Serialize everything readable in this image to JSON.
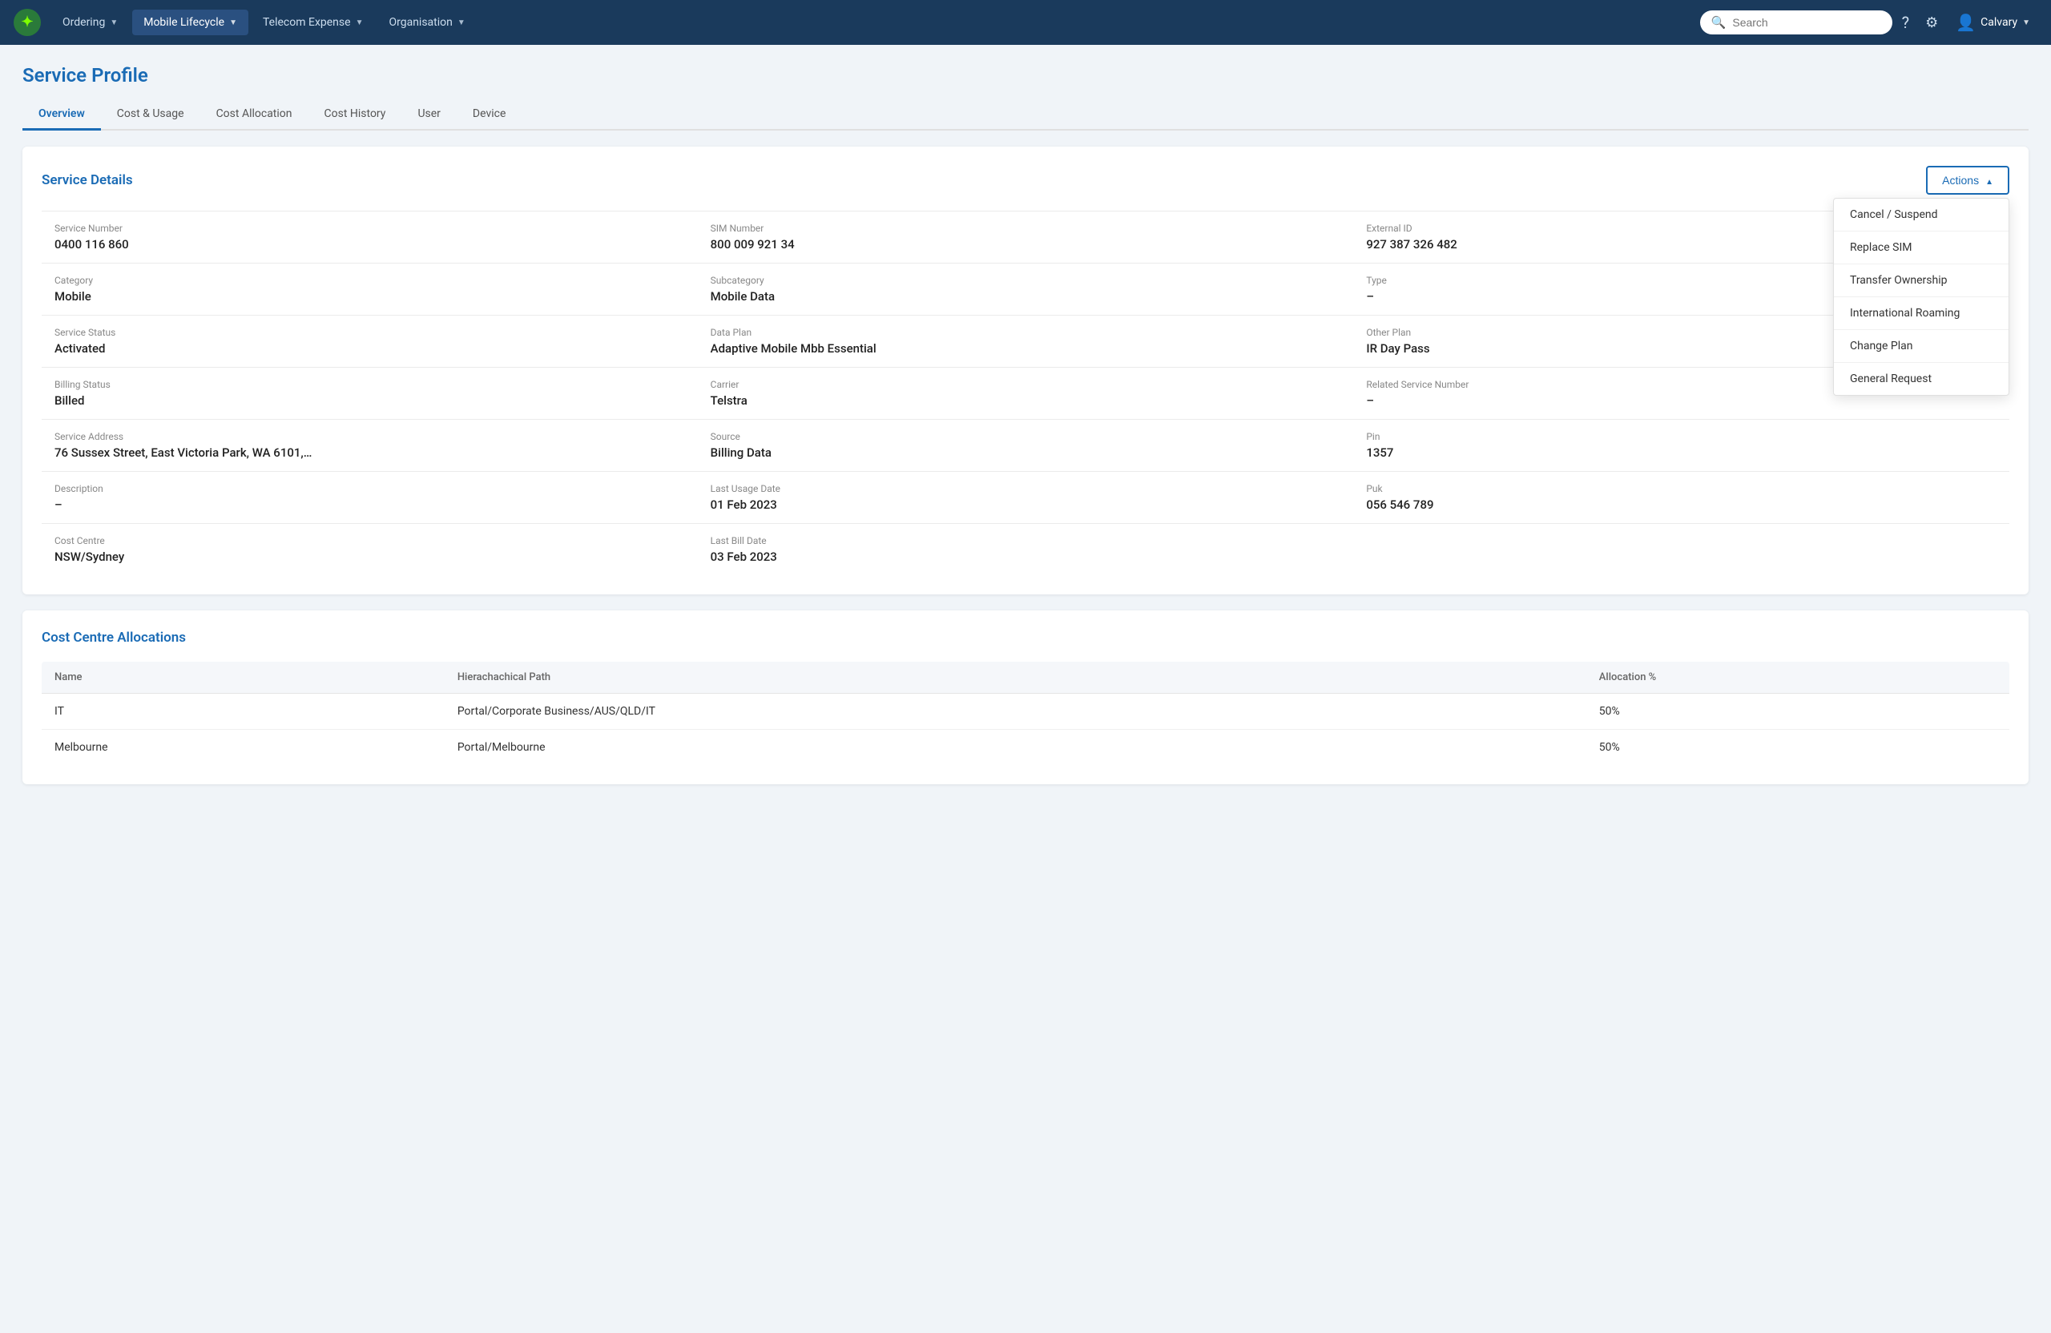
{
  "navbar": {
    "logo_alt": "App Logo",
    "items": [
      {
        "id": "ordering",
        "label": "Ordering",
        "has_chevron": true,
        "active": false
      },
      {
        "id": "mobile-lifecycle",
        "label": "Mobile Lifecycle",
        "has_chevron": true,
        "active": true
      },
      {
        "id": "telecom-expense",
        "label": "Telecom Expense",
        "has_chevron": true,
        "active": false
      },
      {
        "id": "organisation",
        "label": "Organisation",
        "has_chevron": true,
        "active": false
      }
    ],
    "search_placeholder": "Search",
    "user_name": "Calvary"
  },
  "page": {
    "title": "Service Profile",
    "tabs": [
      {
        "id": "overview",
        "label": "Overview",
        "active": true
      },
      {
        "id": "cost-usage",
        "label": "Cost & Usage",
        "active": false
      },
      {
        "id": "cost-allocation",
        "label": "Cost Allocation",
        "active": false
      },
      {
        "id": "cost-history",
        "label": "Cost History",
        "active": false
      },
      {
        "id": "user",
        "label": "User",
        "active": false
      },
      {
        "id": "device",
        "label": "Device",
        "active": false
      }
    ]
  },
  "service_details": {
    "title": "Service Details",
    "actions_label": "Actions",
    "actions_menu": [
      {
        "id": "cancel-suspend",
        "label": "Cancel / Suspend"
      },
      {
        "id": "replace-sim",
        "label": "Replace SIM"
      },
      {
        "id": "transfer-ownership",
        "label": "Transfer Ownership"
      },
      {
        "id": "international-roaming",
        "label": "International Roaming"
      },
      {
        "id": "change-plan",
        "label": "Change Plan"
      },
      {
        "id": "general-request",
        "label": "General Request"
      }
    ],
    "fields": [
      {
        "label": "Service Number",
        "value": "0400 116 860"
      },
      {
        "label": "SIM Number",
        "value": "800 009 921 34"
      },
      {
        "label": "External ID",
        "value": "927 387 326 482"
      },
      {
        "label": "Category",
        "value": "Mobile"
      },
      {
        "label": "Subcategory",
        "value": "Mobile Data"
      },
      {
        "label": "Type",
        "value": "–"
      },
      {
        "label": "Service Status",
        "value": "Activated"
      },
      {
        "label": "Data Plan",
        "value": "Adaptive Mobile Mbb Essential"
      },
      {
        "label": "Other Plan",
        "value": "IR Day Pass"
      },
      {
        "label": "Billing Status",
        "value": "Billed"
      },
      {
        "label": "Carrier",
        "value": "Telstra"
      },
      {
        "label": "Related Service Number",
        "value": "–"
      },
      {
        "label": "Service Address",
        "value": "76 Sussex Street, East Victoria Park, WA 6101,…"
      },
      {
        "label": "Source",
        "value": "Billing Data"
      },
      {
        "label": "Pin",
        "value": "1357"
      },
      {
        "label": "Description",
        "value": "–"
      },
      {
        "label": "Last Usage Date",
        "value": "01 Feb 2023"
      },
      {
        "label": "Puk",
        "value": "056 546 789"
      },
      {
        "label": "Cost Centre",
        "value": "NSW/Sydney"
      },
      {
        "label": "Last Bill Date",
        "value": "03 Feb 2023"
      },
      {
        "label": "",
        "value": ""
      }
    ]
  },
  "cost_centre_allocations": {
    "title": "Cost Centre Allocations",
    "columns": [
      {
        "id": "name",
        "label": "Name"
      },
      {
        "id": "path",
        "label": "Hierachachical Path"
      },
      {
        "id": "allocation",
        "label": "Allocation %"
      }
    ],
    "rows": [
      {
        "name": "IT",
        "path": "Portal/Corporate Business/AUS/QLD/IT",
        "allocation": "50%"
      },
      {
        "name": "Melbourne",
        "path": "Portal/Melbourne",
        "allocation": "50%"
      }
    ]
  }
}
